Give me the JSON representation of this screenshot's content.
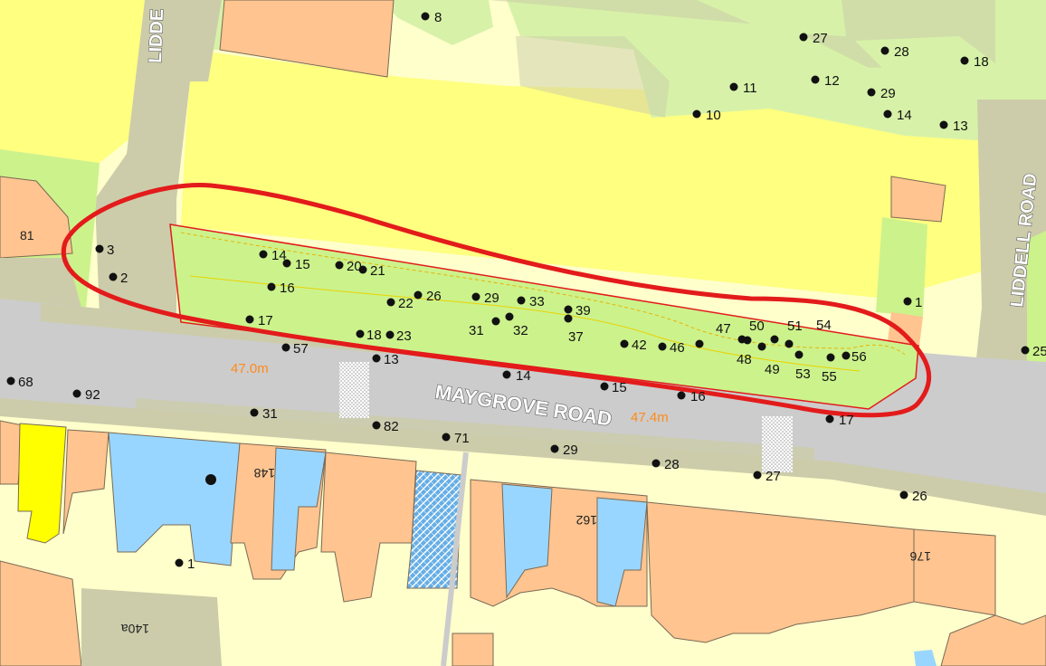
{
  "streets": {
    "maygrove": "MAYGROVE ROAD",
    "liddell_right": "LIDDELL ROAD",
    "liddell_top": "LIDDE"
  },
  "measurements": {
    "m1": "47.0m",
    "m2": "47.4m"
  },
  "house_numbers": {
    "h81": "81",
    "h148": "148",
    "h162": "162",
    "h176": "176",
    "h140a": "140a"
  },
  "colors": {
    "accent": "#e31b1b",
    "parkland": "#ccf28c",
    "greenspace": "#d7f2a8",
    "yellow_block": "#ffff80",
    "road": "#cccccc",
    "pavement": "#cccc99",
    "building": "#ffc48f",
    "blue_building": "#99d6ff",
    "bright_yellow": "#ffff00"
  },
  "tree_points": [
    {
      "label": "8"
    },
    {
      "label": "27"
    },
    {
      "label": "28"
    },
    {
      "label": "18"
    },
    {
      "label": "11"
    },
    {
      "label": "12"
    },
    {
      "label": "29"
    },
    {
      "label": "10"
    },
    {
      "label": "14"
    },
    {
      "label": "13"
    },
    {
      "label": "3"
    },
    {
      "label": "2"
    },
    {
      "label": "14"
    },
    {
      "label": "15"
    },
    {
      "label": "20"
    },
    {
      "label": "21"
    },
    {
      "label": "16"
    },
    {
      "label": "22"
    },
    {
      "label": "26"
    },
    {
      "label": "29"
    },
    {
      "label": "33"
    },
    {
      "label": "39"
    },
    {
      "label": "17"
    },
    {
      "label": "31"
    },
    {
      "label": "32"
    },
    {
      "label": "37"
    },
    {
      "label": "18"
    },
    {
      "label": "23"
    },
    {
      "label": "57"
    },
    {
      "label": "13"
    },
    {
      "label": "42"
    },
    {
      "label": "46"
    },
    {
      "label": "47"
    },
    {
      "label": "50"
    },
    {
      "label": "51"
    },
    {
      "label": "54"
    },
    {
      "label": "48"
    },
    {
      "label": "49"
    },
    {
      "label": "53"
    },
    {
      "label": "55"
    },
    {
      "label": "56"
    },
    {
      "label": "1"
    },
    {
      "label": "25"
    },
    {
      "label": "68"
    },
    {
      "label": "92"
    },
    {
      "label": "14"
    },
    {
      "label": "15"
    },
    {
      "label": "16"
    },
    {
      "label": "17"
    },
    {
      "label": "31"
    },
    {
      "label": "82"
    },
    {
      "label": "71"
    },
    {
      "label": "29"
    },
    {
      "label": "28"
    },
    {
      "label": "27"
    },
    {
      "label": "26"
    },
    {
      "label": "1"
    },
    {
      "label": ""
    }
  ]
}
